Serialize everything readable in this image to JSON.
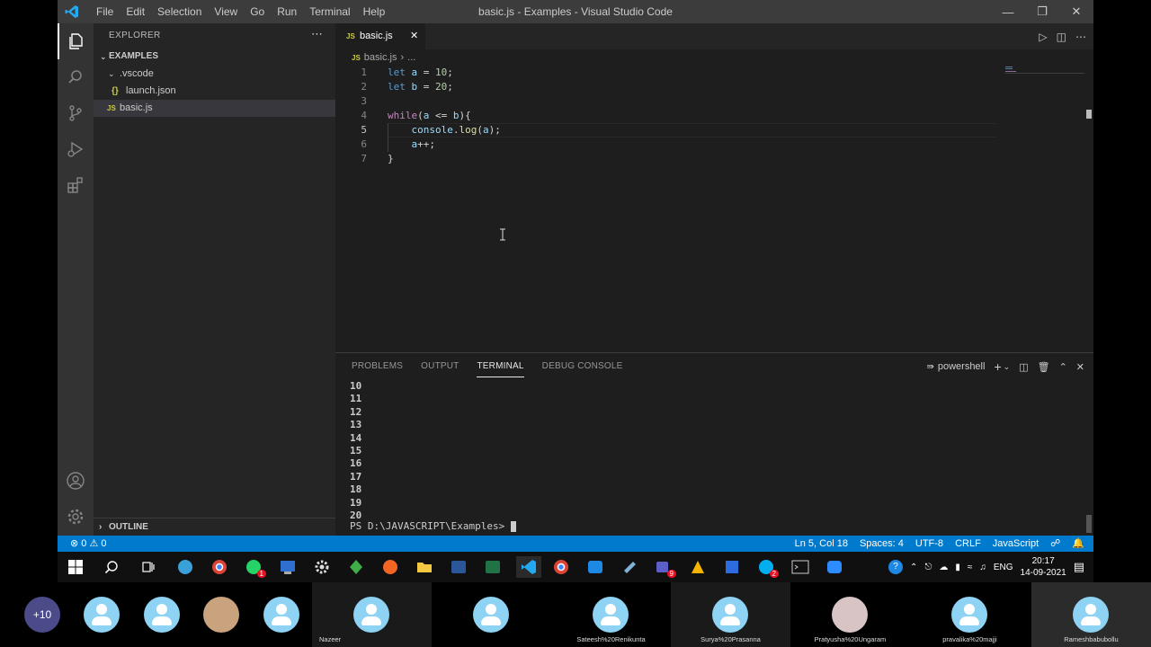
{
  "window": {
    "title": "basic.js - Examples - Visual Studio Code",
    "menu": [
      "File",
      "Edit",
      "Selection",
      "View",
      "Go",
      "Run",
      "Terminal",
      "Help"
    ]
  },
  "sidebar": {
    "title": "EXPLORER",
    "section": "EXAMPLES",
    "items": [
      {
        "icon": "chevron-down-icon",
        "label": ".vscode"
      },
      {
        "icon": "json-file-icon",
        "label": "launch.json"
      },
      {
        "icon": "js-file-icon",
        "label": "basic.js"
      }
    ],
    "outline": "OUTLINE"
  },
  "editor": {
    "tab_label": "basic.js",
    "file_badge": "JS",
    "breadcrumb_file": "basic.js",
    "breadcrumb_rest": "...",
    "line_numbers": [
      "1",
      "2",
      "3",
      "4",
      "5",
      "6",
      "7"
    ],
    "lines": [
      "let a = 10;",
      "let b = 20;",
      "",
      "while(a <= b){",
      "    console.log(a);",
      "    a++;",
      "}"
    ]
  },
  "panel": {
    "tabs": [
      "PROBLEMS",
      "OUTPUT",
      "TERMINAL",
      "DEBUG CONSOLE"
    ],
    "active_tab": "TERMINAL",
    "shell": "powershell",
    "output": [
      "10",
      "11",
      "12",
      "13",
      "14",
      "15",
      "16",
      "17",
      "18",
      "19",
      "20"
    ],
    "prompt": "PS D:\\JAVASCRIPT\\Examples> "
  },
  "statusbar": {
    "errors": "0",
    "warnings": "0",
    "position": "Ln 5, Col 18",
    "spaces": "Spaces: 4",
    "encoding": "UTF-8",
    "eol": "CRLF",
    "language": "JavaScript"
  },
  "taskbar": {
    "lang": "ENG",
    "time": "20:17",
    "date": "14-09-2021",
    "whatsapp_badge": "1",
    "teams_badge": "9",
    "skype_badge": "2"
  },
  "participants": {
    "more": "+10",
    "names": [
      "Nazeer",
      "Sateesh%20Renikunta",
      "Surya%20Prasanna",
      "Pratyusha%20Ungaram",
      "pravalika%20majji",
      "Rameshbabubollu"
    ]
  },
  "colors": {
    "accent": "#007acc",
    "editor_bg": "#1e1e1e",
    "sidebar_bg": "#252526",
    "keyword": "#569cd6",
    "number": "#b5cea8",
    "function": "#dcdcaa",
    "control": "#c586c0"
  }
}
